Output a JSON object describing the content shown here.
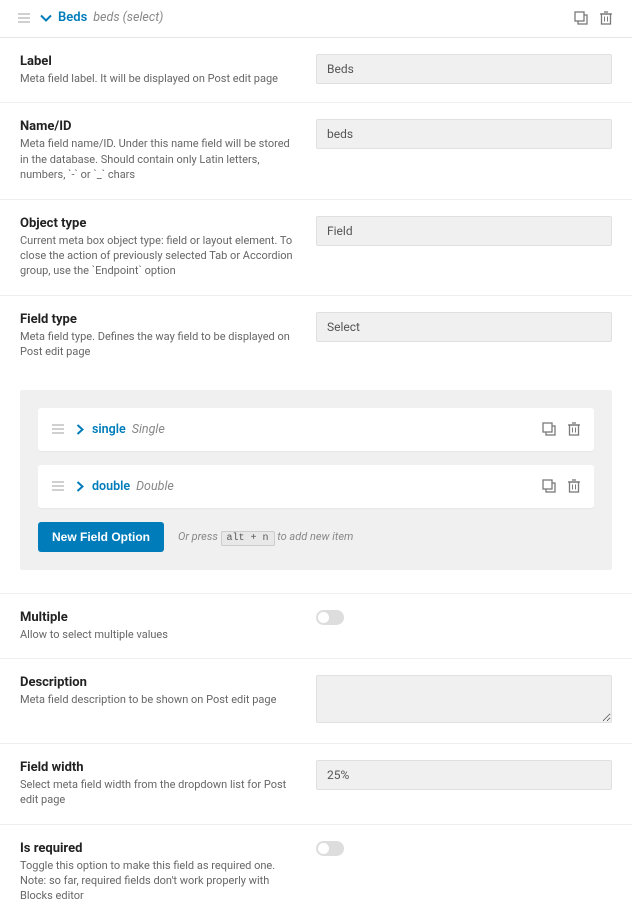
{
  "header": {
    "title": "Beds",
    "subtitle": "beds (select)"
  },
  "fields": {
    "label": {
      "title": "Label",
      "desc": "Meta field label. It will be displayed on Post edit page",
      "value": "Beds"
    },
    "name_id": {
      "title": "Name/ID",
      "desc": "Meta field name/ID. Under this name field will be stored in the database. Should contain only Latin letters, numbers, `-` or `_` chars",
      "value": "beds"
    },
    "object_type": {
      "title": "Object type",
      "desc": "Current meta box object type: field or layout element. To close the action of previously selected Tab or Accordion group, use the `Endpoint` option",
      "value": "Field"
    },
    "field_type": {
      "title": "Field type",
      "desc": "Meta field type. Defines the way field to be displayed on Post edit page",
      "value": "Select"
    },
    "multiple": {
      "title": "Multiple",
      "desc": "Allow to select multiple values"
    },
    "description": {
      "title": "Description",
      "desc": "Meta field description to be shown on Post edit page",
      "value": ""
    },
    "field_width": {
      "title": "Field width",
      "desc": "Select meta field width from the dropdown list for Post edit page",
      "value": "25%"
    },
    "is_required": {
      "title": "Is required",
      "desc": "Toggle this option to make this field as required one. Note: so far, required fields don't work properly with Blocks editor"
    }
  },
  "options": [
    {
      "name": "single",
      "label": "Single"
    },
    {
      "name": "double",
      "label": "Double"
    }
  ],
  "buttons": {
    "new_option": "New Field Option",
    "or_press_pre": "Or press",
    "kbd": "alt + n",
    "or_press_post": "to add new item"
  }
}
